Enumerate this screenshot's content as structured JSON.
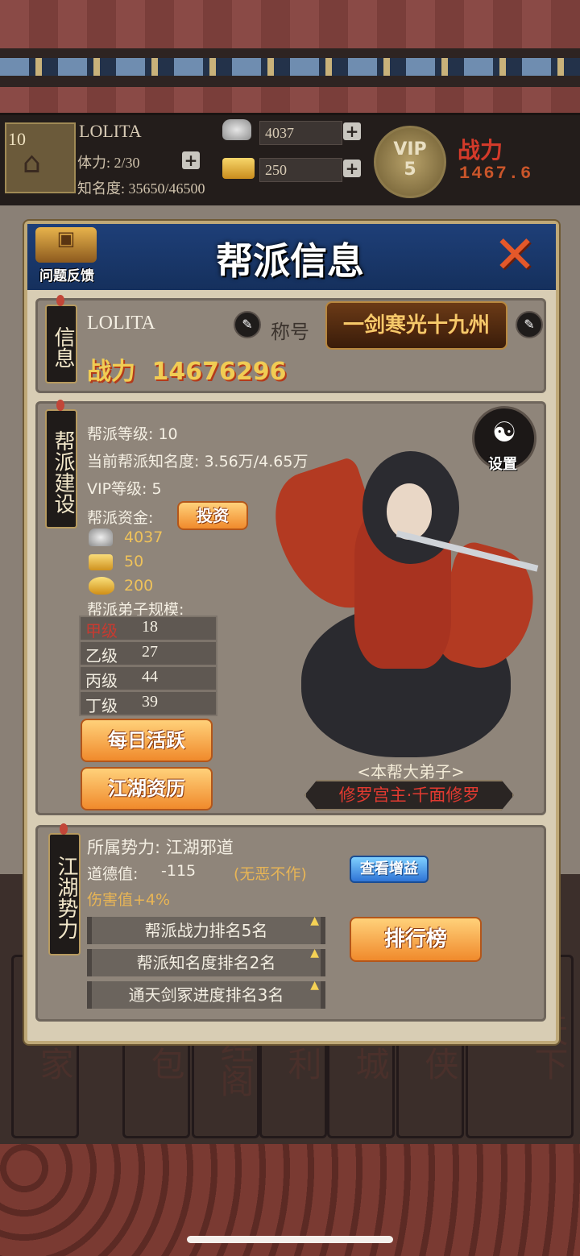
{
  "hud": {
    "level": "10",
    "player_name": "LOLITA",
    "stamina": "体力: 2/30",
    "fame": "知名度: 35650/46500",
    "silver": "4037",
    "gold": "250",
    "vip_label": "VIP",
    "vip_level": "5",
    "power_label": "战力",
    "power_value": "1467.6"
  },
  "bottom_nav": [
    "剑家",
    "背包",
    "藏经阁",
    "福利",
    "商城",
    "寻侠",
    "天下"
  ],
  "modal": {
    "title": "帮派信息",
    "feedback_label": "问题反馈",
    "info": {
      "tag": "信息",
      "name": "LOLITA",
      "title_label": "称号",
      "title_badge": "一剑寒光十九州",
      "power_label": "战力",
      "power_value": "14676296"
    },
    "build": {
      "tag": "帮派建设",
      "level": "帮派等级:  10",
      "fame": "当前帮派知名度: 3.56万/4.65万",
      "vip": "VIP等级:  5",
      "funds_label": "帮派资金:",
      "invest_btn": "投资",
      "silver": "4037",
      "gold_bar": "50",
      "gold_ingot": "200",
      "scale_label": "帮派弟子规模:",
      "scale": [
        {
          "grade": "甲级",
          "count": "18"
        },
        {
          "grade": "乙级",
          "count": "27"
        },
        {
          "grade": "丙级",
          "count": "44"
        },
        {
          "grade": "丁级",
          "count": "39"
        }
      ],
      "daily_btn": "每日活跃",
      "jianghu_btn": "江湖资历",
      "settings_label": "设置",
      "disciple_title": "<本帮大弟子>",
      "disciple_name": "修罗宫主·千面修罗"
    },
    "faction": {
      "tag": "江湖势力",
      "affiliation": "所属势力: 江湖邪道",
      "morality_label": "道德值:",
      "morality_value": "-115",
      "morality_status": "(无恶不作)",
      "view_bonus_btn": "查看增益",
      "damage": "伤害值+4%",
      "ranks": [
        "帮派战力排名5名",
        "帮派知名度排名2名",
        "通天剑冢进度排名3名"
      ],
      "leaderboard_btn": "排行榜"
    }
  }
}
